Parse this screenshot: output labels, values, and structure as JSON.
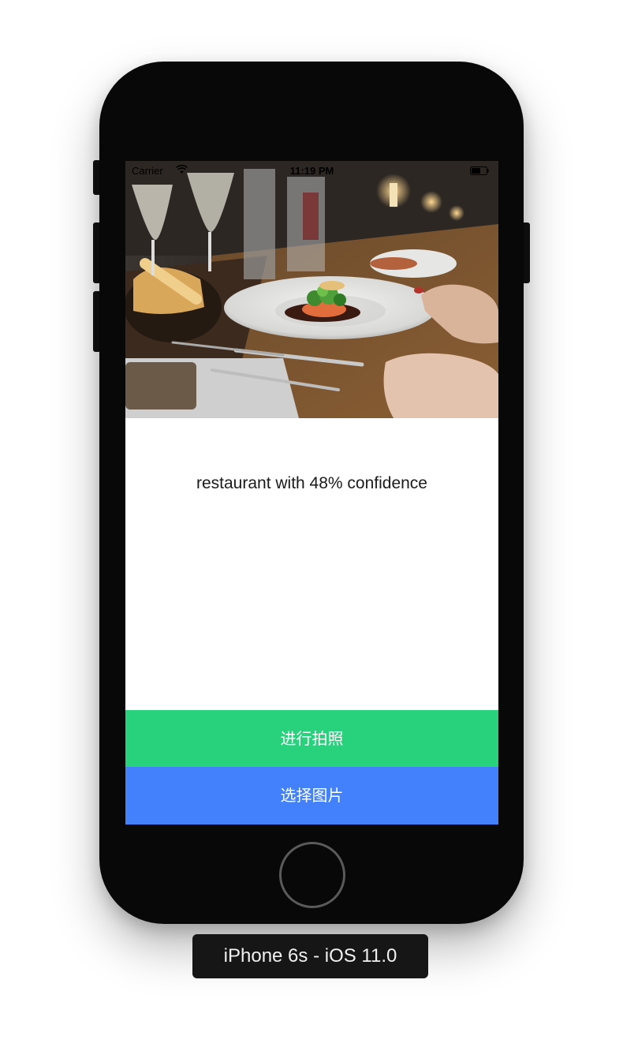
{
  "status_bar": {
    "carrier": "Carrier",
    "time": "11:19 PM",
    "wifi_icon": "wifi-icon",
    "battery_icon": "battery-icon"
  },
  "photo": {
    "subject": "restaurant-table-photo"
  },
  "result": {
    "text": "restaurant with 48% confidence"
  },
  "actions": {
    "camera_label": "进行拍照",
    "album_label": "选择图片",
    "camera_color": "#28d17c",
    "album_color": "#4380fb"
  },
  "simulator": {
    "device_label": "iPhone 6s - iOS 11.0"
  }
}
